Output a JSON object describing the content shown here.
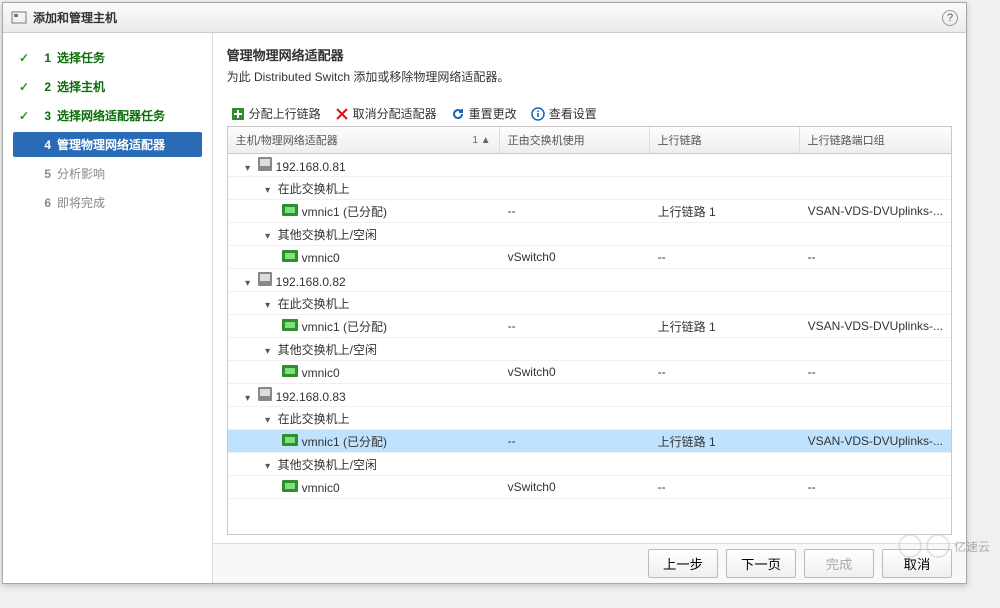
{
  "dialog": {
    "title": "添加和管理主机"
  },
  "steps": [
    {
      "num": "1",
      "label": "选择任务",
      "state": "done"
    },
    {
      "num": "2",
      "label": "选择主机",
      "state": "done"
    },
    {
      "num": "3",
      "label": "选择网络适配器任务",
      "state": "done"
    },
    {
      "num": "4",
      "label": "管理物理网络适配器",
      "state": "current"
    },
    {
      "num": "5",
      "label": "分析影响",
      "state": "pending"
    },
    {
      "num": "6",
      "label": "即将完成",
      "state": "pending"
    }
  ],
  "section": {
    "title": "管理物理网络适配器",
    "desc": "为此 Distributed Switch 添加或移除物理网络适配器。"
  },
  "toolbar": {
    "assign": "分配上行链路",
    "unassign": "取消分配适配器",
    "reset": "重置更改",
    "view": "查看设置"
  },
  "columns": {
    "c1": "主机/物理网络适配器",
    "c2": "正由交换机使用",
    "c3": "上行链路",
    "c4": "上行链路端口组",
    "sort": "1 ▲"
  },
  "rows": [
    {
      "kind": "host",
      "pad": 0,
      "label": "192.168.0.81",
      "c2": "",
      "c3": "",
      "c4": "",
      "sel": false
    },
    {
      "kind": "group",
      "pad": 1,
      "label": "在此交换机上",
      "c2": "",
      "c3": "",
      "c4": "",
      "sel": false
    },
    {
      "kind": "nic",
      "pad": 2,
      "label": "vmnic1 (已分配)",
      "c2": "--",
      "c3": "上行链路 1",
      "c4": "VSAN-VDS-DVUplinks-...",
      "sel": false
    },
    {
      "kind": "group",
      "pad": 1,
      "label": "其他交换机上/空闲",
      "c2": "",
      "c3": "",
      "c4": "",
      "sel": false
    },
    {
      "kind": "nic",
      "pad": 2,
      "label": "vmnic0",
      "c2": "vSwitch0",
      "c3": "--",
      "c4": "--",
      "sel": false
    },
    {
      "kind": "host",
      "pad": 0,
      "label": "192.168.0.82",
      "c2": "",
      "c3": "",
      "c4": "",
      "sel": false
    },
    {
      "kind": "group",
      "pad": 1,
      "label": "在此交换机上",
      "c2": "",
      "c3": "",
      "c4": "",
      "sel": false
    },
    {
      "kind": "nic",
      "pad": 2,
      "label": "vmnic1 (已分配)",
      "c2": "--",
      "c3": "上行链路 1",
      "c4": "VSAN-VDS-DVUplinks-...",
      "sel": false
    },
    {
      "kind": "group",
      "pad": 1,
      "label": "其他交换机上/空闲",
      "c2": "",
      "c3": "",
      "c4": "",
      "sel": false
    },
    {
      "kind": "nic",
      "pad": 2,
      "label": "vmnic0",
      "c2": "vSwitch0",
      "c3": "--",
      "c4": "--",
      "sel": false
    },
    {
      "kind": "host",
      "pad": 0,
      "label": "192.168.0.83",
      "c2": "",
      "c3": "",
      "c4": "",
      "sel": false
    },
    {
      "kind": "group",
      "pad": 1,
      "label": "在此交换机上",
      "c2": "",
      "c3": "",
      "c4": "",
      "sel": false
    },
    {
      "kind": "nic",
      "pad": 2,
      "label": "vmnic1 (已分配)",
      "c2": "--",
      "c3": "上行链路 1",
      "c4": "VSAN-VDS-DVUplinks-...",
      "sel": true
    },
    {
      "kind": "group",
      "pad": 1,
      "label": "其他交换机上/空闲",
      "c2": "",
      "c3": "",
      "c4": "",
      "sel": false
    },
    {
      "kind": "nic",
      "pad": 2,
      "label": "vmnic0",
      "c2": "vSwitch0",
      "c3": "--",
      "c4": "--",
      "sel": false
    }
  ],
  "footer": {
    "back": "上一步",
    "next": "下一页",
    "finish": "完成",
    "cancel": "取消"
  },
  "watermark": "亿速云"
}
